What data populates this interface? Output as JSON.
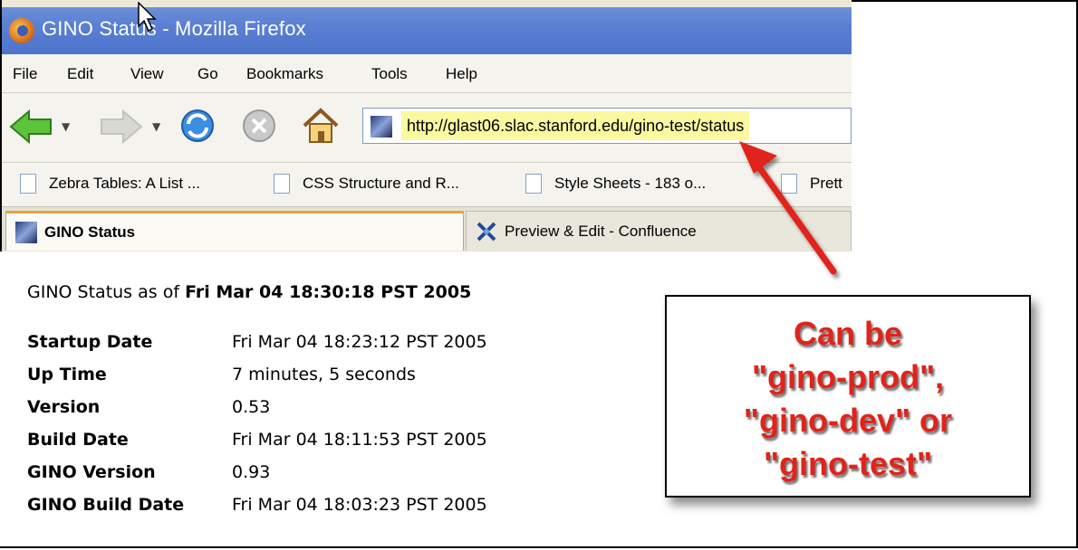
{
  "window": {
    "title": "GINO Status - Mozilla Firefox"
  },
  "menu": [
    "File",
    "Edit",
    "View",
    "Go",
    "Bookmarks",
    "Tools",
    "Help"
  ],
  "navigation": {
    "url": "http://glast06.slac.stanford.edu/gino-test/status",
    "buttons": [
      "back-icon",
      "forward-icon",
      "reload-icon",
      "stop-icon",
      "home-icon"
    ]
  },
  "bookmarks": [
    {
      "label": "Zebra Tables: A List ..."
    },
    {
      "label": "CSS Structure and R..."
    },
    {
      "label": "Style Sheets - 183 o..."
    },
    {
      "label": "Prett"
    }
  ],
  "tabs": [
    {
      "label": "GINO Status",
      "active": true
    },
    {
      "label": "Preview & Edit - Confluence",
      "active": false
    }
  ],
  "page": {
    "status_prefix": "GINO Status as of ",
    "status_time": "Fri Mar 04 18:30:18 PST 2005",
    "rows": [
      {
        "label": "Startup Date",
        "value": "Fri Mar 04 18:23:12 PST 2005"
      },
      {
        "label": "Up Time",
        "value": "7 minutes, 5 seconds"
      },
      {
        "label": "Version",
        "value": "0.53"
      },
      {
        "label": "Build Date",
        "value": "Fri Mar 04 18:11:53 PST 2005"
      },
      {
        "label": "GINO Version",
        "value": "0.93"
      },
      {
        "label": "GINO Build Date",
        "value": "Fri Mar 04 18:03:23 PST 2005"
      }
    ]
  },
  "annotation": {
    "lines": [
      "Can be",
      "\"gino-prod\",",
      "\"gino-dev\" or",
      "\"gino-test\""
    ],
    "color": "#e2231a"
  },
  "colors": {
    "titlebar": "#5a7fd3",
    "url_highlight": "#fbf8a0",
    "active_tab_accent": "#e8a23a"
  }
}
